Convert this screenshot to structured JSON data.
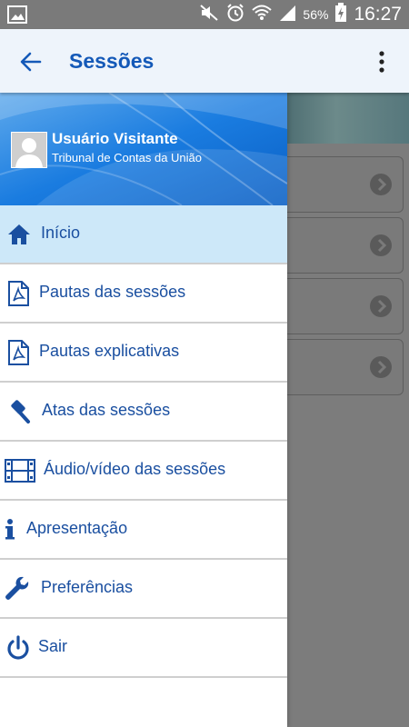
{
  "status_bar": {
    "battery": "56%",
    "time": "16:27"
  },
  "app_bar": {
    "title": "Sessões"
  },
  "drawer": {
    "user_name": "Usuário Visitante",
    "organization": "Tribunal de Contas da União",
    "items": [
      {
        "label": "Início",
        "icon": "home-icon",
        "active": true
      },
      {
        "label": "Pautas das sessões",
        "icon": "pdf-file-icon"
      },
      {
        "label": "Pautas explicativas",
        "icon": "pdf-file-icon"
      },
      {
        "label": "Atas das sessões",
        "icon": "gavel-icon"
      },
      {
        "label": "Áudio/vídeo das sessões",
        "icon": "film-icon"
      },
      {
        "label": "Apresentação",
        "icon": "info-icon"
      },
      {
        "label": "Preferências",
        "icon": "wrench-icon"
      },
      {
        "label": "Sair",
        "icon": "power-icon"
      }
    ]
  },
  "colors": {
    "accent": "#1459b8",
    "active_row": "#cde8f9",
    "header_blue": "#0b6cd6"
  }
}
